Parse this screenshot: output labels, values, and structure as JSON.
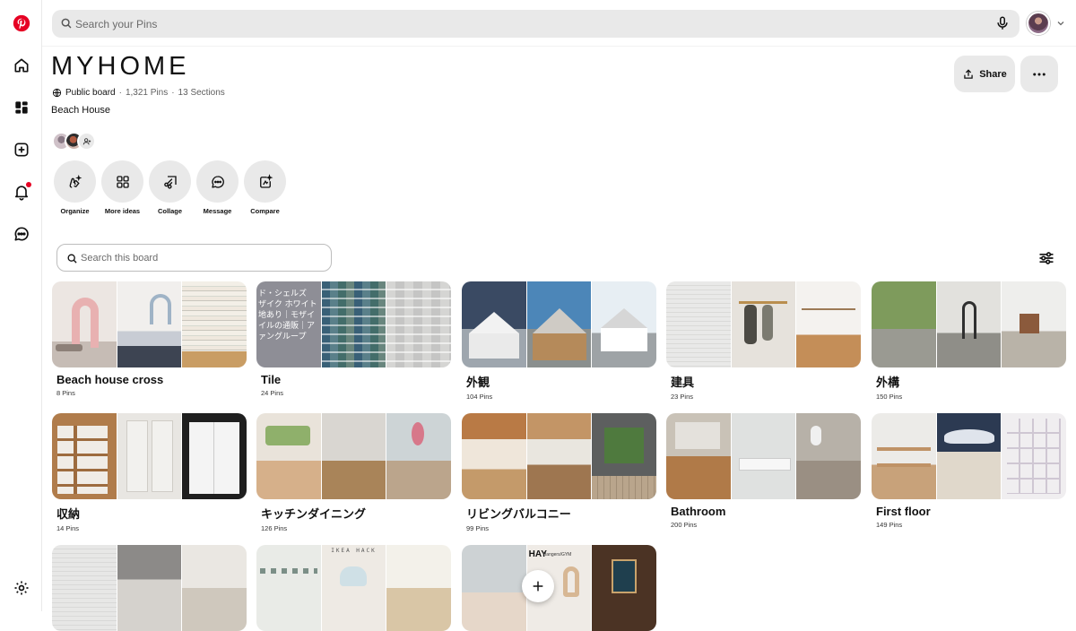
{
  "search": {
    "placeholder": "Search your Pins"
  },
  "board": {
    "title": "MYHOME",
    "visibility": "Public board",
    "pins": "1,321 Pins",
    "sections": "13 Sections",
    "meta_sep": "·",
    "description": "Beach House"
  },
  "actions": {
    "share_label": "Share"
  },
  "tools": [
    {
      "label": "Organize",
      "icon": "organize-icon"
    },
    {
      "label": "More ideas",
      "icon": "grid-icon"
    },
    {
      "label": "Collage",
      "icon": "collage-icon"
    },
    {
      "label": "Message",
      "icon": "message-icon"
    },
    {
      "label": "Compare",
      "icon": "compare-icon"
    }
  ],
  "board_search": {
    "placeholder": "Search this board"
  },
  "sections": [
    {
      "name": "Beach house cross",
      "count": "8 Pins"
    },
    {
      "name": "Tile",
      "count": "24 Pins",
      "overlay": [
        "ド・シェルズ",
        "ザイク ホワイト",
        "地あり｜モザイ",
        "イルの通販｜ア",
        "ァングループ"
      ]
    },
    {
      "name": "外観",
      "count": "104 Pins"
    },
    {
      "name": "建具",
      "count": "23 Pins"
    },
    {
      "name": "外構",
      "count": "150 Pins"
    },
    {
      "name": "収納",
      "count": "14 Pins"
    },
    {
      "name": "キッチンダイニング",
      "count": "126 Pins"
    },
    {
      "name": "リビングバルコニー",
      "count": "99 Pins"
    },
    {
      "name": "Bathroom",
      "count": "200 Pins"
    },
    {
      "name": "First floor",
      "count": "149 Pins"
    }
  ],
  "row3": {
    "ikea_text": "IKEA HACK",
    "hay_text": "HAY",
    "hay_sub": "Hangers/GYM"
  },
  "colors": {
    "brand": "#e60023",
    "pill_bg": "#e9e9e9"
  }
}
